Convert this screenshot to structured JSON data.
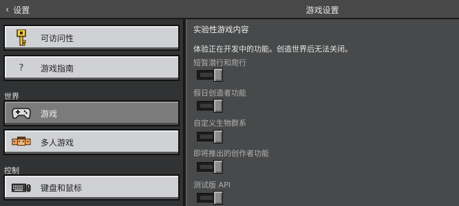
{
  "header": {
    "back_label": "设置",
    "title": "游戏设置"
  },
  "sidebar": {
    "items": [
      {
        "label": "可访问性",
        "icon": "key-icon"
      },
      {
        "label": "游戏指南",
        "icon": "question-icon",
        "glyph": "?"
      },
      {
        "label": "游戏",
        "icon": "controller-icon",
        "selected": true
      },
      {
        "label": "多人游戏",
        "icon": "multiplayer-icon"
      },
      {
        "label": "键盘和鼠标",
        "icon": "keyboard-mouse-icon"
      }
    ],
    "sections": {
      "world": "世界",
      "controls": "控制"
    }
  },
  "main": {
    "title": "实验性游戏内容",
    "description": "体验正在开发中的功能。创造世界后无法关闭。",
    "options": [
      {
        "label": "短暂潜行和爬行",
        "enabled": false
      },
      {
        "label": "假日创造者功能",
        "enabled": false
      },
      {
        "label": "自定义生物群系",
        "enabled": false
      },
      {
        "label": "即将推出的创作者功能",
        "enabled": false
      },
      {
        "label": "测试版 API",
        "enabled": false
      }
    ]
  },
  "colors": {
    "button_face": "#d0d1d4",
    "button_selected": "#7b7b7c",
    "panel_right": "#48494a",
    "panel_left": "#313233"
  }
}
